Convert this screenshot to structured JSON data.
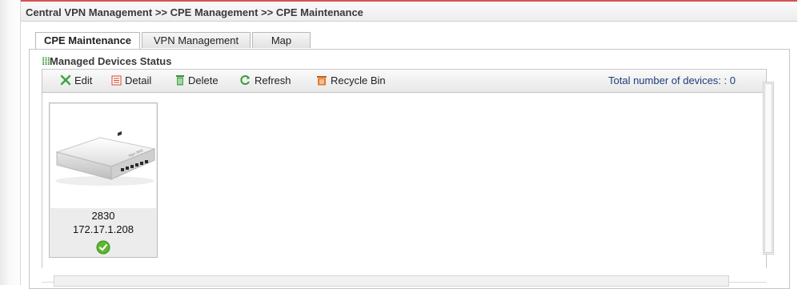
{
  "breadcrumb": {
    "text": "Central VPN Management >> CPE Management >> CPE Maintenance"
  },
  "tabs": [
    {
      "label": "CPE Maintenance",
      "active": true
    },
    {
      "label": "VPN Management",
      "active": false
    },
    {
      "label": "Map",
      "active": false
    }
  ],
  "section": {
    "title": "Managed Devices Status",
    "icon": "grid-icon"
  },
  "toolbar": {
    "edit_label": "Edit",
    "detail_label": "Detail",
    "delete_label": "Delete",
    "refresh_label": "Refresh",
    "recycle_label": "Recycle Bin",
    "total_label": "Total number of devices: : 0"
  },
  "devices": [
    {
      "model": "2830",
      "ip": "172.17.1.208",
      "status_icon": "check-circle-icon"
    }
  ],
  "colors": {
    "accent": "#d55353",
    "grid_green": "#2f9c2f",
    "total_blue": "#1c3d7a",
    "status_green": "#5cb82f"
  }
}
